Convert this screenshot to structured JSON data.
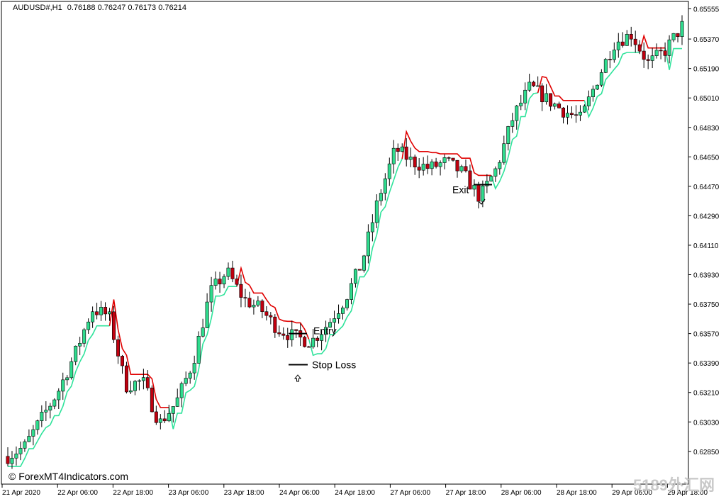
{
  "header": {
    "symbol": "AUDUSD#,H1",
    "ohlc": "0.76188 0.76247 0.76173 0.76214"
  },
  "credit": "© ForexMT4Indicators.com",
  "watermark": "5189外汇网",
  "colors": {
    "bull": "#2fdc8e",
    "bear": "#c0000f",
    "stop_line": "#2fe39b",
    "stop_line_bear": "#e00000",
    "frame": "#000000"
  },
  "annotations": {
    "entry_label": "Entry",
    "stop_label": "Stop Loss",
    "exit_label": "Exit",
    "entry_icon": "up-arrow-icon",
    "exit_icon": "check-icon"
  },
  "chart_data": {
    "type": "candlestick",
    "y_ticks": [
      "0.65555",
      "0.65370",
      "0.65190",
      "0.65010",
      "0.64830",
      "0.64650",
      "0.64470",
      "0.64290",
      "0.64110",
      "0.63930",
      "0.63750",
      "0.63570",
      "0.63390",
      "0.63210",
      "0.63030",
      "0.62850"
    ],
    "ylim": [
      0.6265,
      0.656
    ],
    "x_ticks": [
      "21 Apr 2020",
      "22 Apr 06:00",
      "22 Apr 18:00",
      "23 Apr 06:00",
      "23 Apr 18:00",
      "24 Apr 06:00",
      "24 Apr 18:00",
      "27 Apr 06:00",
      "27 Apr 18:00",
      "28 Apr 06:00",
      "28 Apr 18:00",
      "29 Apr 06:00",
      "29 Apr 18:00"
    ],
    "trade": {
      "entry_price": 0.6357,
      "stop_price": 0.6338,
      "exit_price": 0.6448
    },
    "key_closes": [
      0.6282,
      0.6288,
      0.6305,
      0.6322,
      0.6345,
      0.6372,
      0.6368,
      0.6325,
      0.6328,
      0.6302,
      0.6315,
      0.634,
      0.6382,
      0.6395,
      0.6378,
      0.6372,
      0.636,
      0.6355,
      0.6352,
      0.6363,
      0.6378,
      0.64,
      0.644,
      0.647,
      0.6462,
      0.6458,
      0.6462,
      0.6455,
      0.644,
      0.6458,
      0.649,
      0.6508,
      0.65,
      0.6493,
      0.6488,
      0.6513,
      0.6535,
      0.654,
      0.6522,
      0.653,
      0.6545
    ]
  }
}
